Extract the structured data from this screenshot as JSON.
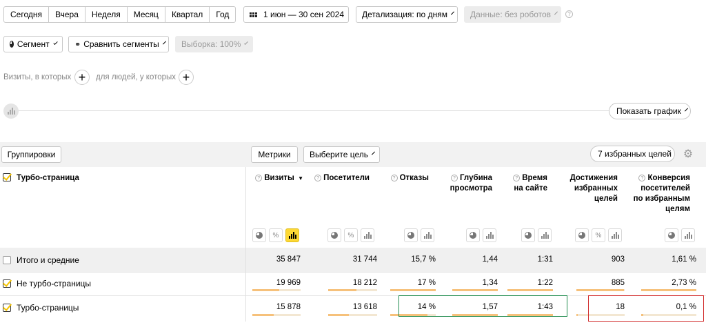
{
  "periods": [
    "Сегодня",
    "Вчера",
    "Неделя",
    "Месяц",
    "Квартал",
    "Год"
  ],
  "date_range": "1 июн — 30 сен 2024",
  "detail": "Детализация: по дням",
  "data_filter": "Данные: без роботов",
  "segment": "Сегмент",
  "compare": "Сравнить сегменты",
  "sample": "Выборка: 100%",
  "visits_which": "Визиты, в которых",
  "people_which": "для людей, у которых",
  "show_chart": "Показать график",
  "groupings": "Группировки",
  "metrics": "Метрики",
  "choose_goal": "Выберите цель",
  "favorites": "7 избранных целей",
  "dimension_header": "Турбо-страница",
  "columns": [
    "Визиты",
    "Посетители",
    "Отказы",
    "Глубина просмотра",
    "Время на сайте",
    "Достижения избранных целей",
    "Конверсия посетителей по избранным целям"
  ],
  "sort_column": "Визиты",
  "rows": [
    {
      "label": "Итого и средние",
      "checked": false,
      "values": [
        "35 847",
        "31 744",
        "15,7 %",
        "1,44",
        "1:31",
        "903",
        "1,61 %"
      ]
    },
    {
      "label": "Не турбо-страницы",
      "checked": true,
      "values": [
        "19 969",
        "18 212",
        "17 %",
        "1,34",
        "1:22",
        "885",
        "2,73 %"
      ],
      "shares": [
        0.557,
        0.574,
        1,
        1,
        1,
        0.98,
        1
      ]
    },
    {
      "label": "Турбо-страницы",
      "checked": true,
      "values": [
        "15 878",
        "13 618",
        "14 %",
        "1,57",
        "1:43",
        "18",
        "0,1 %"
      ],
      "shares": [
        0.443,
        0.429,
        0.82,
        1,
        1,
        0.02,
        0.04
      ]
    }
  ],
  "colors": {
    "accent": "#fdd835",
    "bar": "#f6c17b",
    "highlight_green": "#1d8a4c",
    "highlight_red": "#d12b2b"
  }
}
